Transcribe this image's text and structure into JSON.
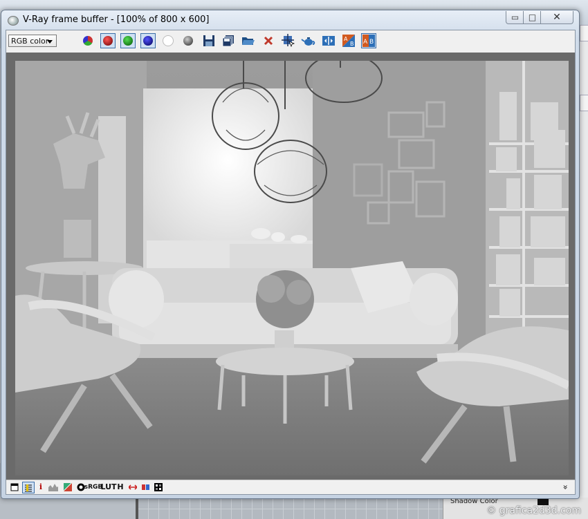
{
  "window": {
    "title": "V-Ray frame buffer - [100% of 800 x 600]",
    "buttons": {
      "minimize": "▭",
      "maximize": "□",
      "close": "✕"
    }
  },
  "toolbar": {
    "channel": "RGB color",
    "icons": [
      "rgb-channels-icon",
      "red-channel-icon",
      "green-channel-icon",
      "blue-channel-icon",
      "alpha-channel-icon",
      "monochrome-icon",
      "save-image-icon",
      "save-all-icon",
      "load-image-icon",
      "clear-image-icon",
      "track-mouse-icon",
      "render-teapot-icon",
      "compare-horizontal-icon",
      "ab-vertical-icon",
      "ab-horizontal-icon"
    ]
  },
  "statusbar": {
    "lut_label": "LUT",
    "history_label": "H",
    "expand_glyph": "»"
  },
  "background": {
    "properties_label": "Shadow Color",
    "watermark": "© grafica2d3d.com"
  },
  "colors": {
    "window_frame": "#c6d3e3",
    "render_tint": "#a3a3a3",
    "red_channel": "#c0392b",
    "green_channel": "#27ae60",
    "blue_channel": "#2c3e9e"
  }
}
